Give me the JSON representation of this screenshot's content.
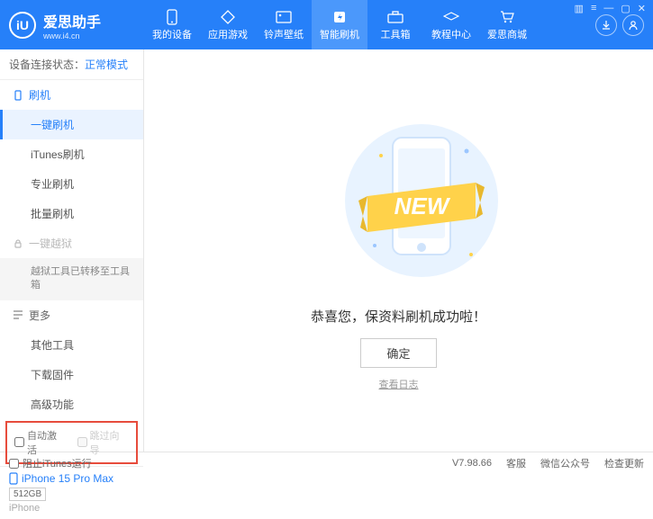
{
  "app": {
    "name": "爱思助手",
    "url": "www.i4.cn",
    "logo_letter": "iU"
  },
  "win": {
    "menu": "▥",
    "tools": "≡",
    "min": "—",
    "max": "▢",
    "close": "✕"
  },
  "nav": [
    {
      "label": "我的设备"
    },
    {
      "label": "应用游戏"
    },
    {
      "label": "铃声壁纸"
    },
    {
      "label": "智能刷机",
      "active": true
    },
    {
      "label": "工具箱"
    },
    {
      "label": "教程中心"
    },
    {
      "label": "爱思商城"
    }
  ],
  "sidebar": {
    "status_label": "设备连接状态：",
    "status_mode": "正常模式",
    "sec_flash": "刷机",
    "items_flash": [
      {
        "label": "一键刷机",
        "active": true
      },
      {
        "label": "iTunes刷机"
      },
      {
        "label": "专业刷机"
      },
      {
        "label": "批量刷机"
      }
    ],
    "sec_jailbreak": "一键越狱",
    "jailbreak_note": "越狱工具已转移至工具箱",
    "sec_more": "更多",
    "items_more": [
      {
        "label": "其他工具"
      },
      {
        "label": "下载固件"
      },
      {
        "label": "高级功能"
      }
    ],
    "cb_auto_activate": "自动激活",
    "cb_skip_guide": "跳过向导",
    "device_name": "iPhone 15 Pro Max",
    "device_storage": "512GB",
    "device_type": "iPhone"
  },
  "main": {
    "success_text": "恭喜您，保资料刷机成功啦！",
    "ok": "确定",
    "view_log": "查看日志",
    "new_badge": "NEW"
  },
  "footer": {
    "block_itunes": "阻止iTunes运行",
    "version": "V7.98.66",
    "support": "客服",
    "wechat": "微信公众号",
    "check_update": "检查更新"
  },
  "colors": {
    "primary": "#2680f9",
    "accent": "#ffd24a"
  }
}
